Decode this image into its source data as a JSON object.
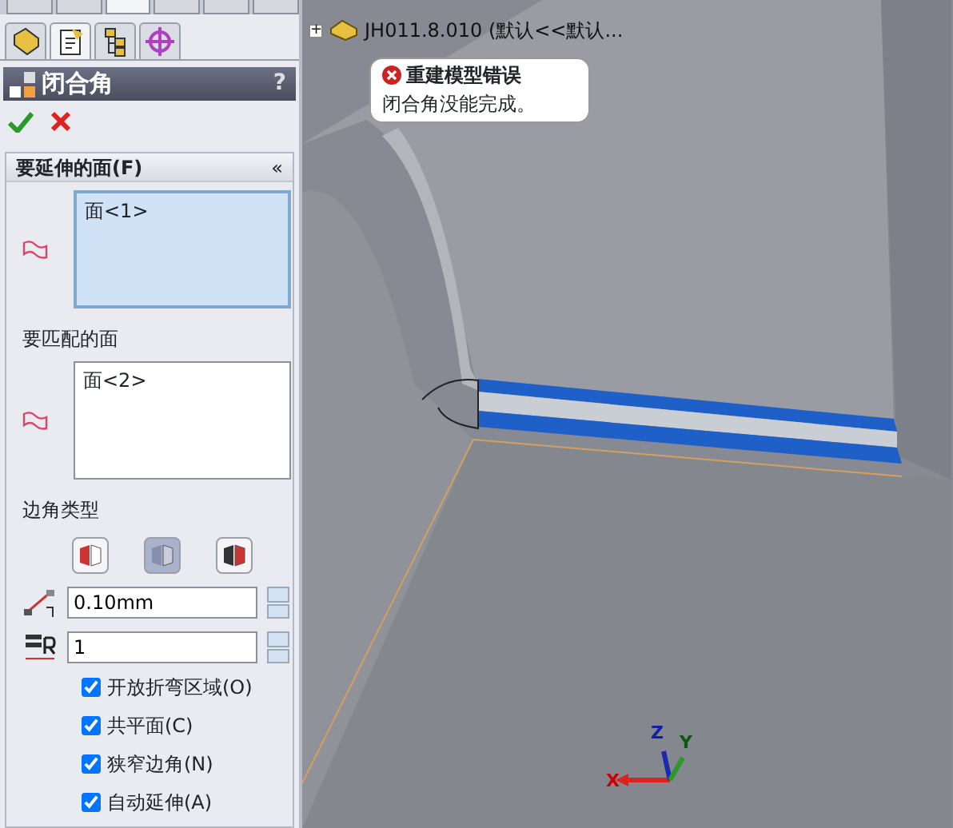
{
  "top_tabs": [
    {
      "selected": false
    },
    {
      "selected": false
    },
    {
      "selected": true
    },
    {
      "selected": false
    },
    {
      "selected": false
    },
    {
      "selected": false
    }
  ],
  "panel_tabs": [
    {
      "selected": false
    },
    {
      "selected": true
    },
    {
      "selected": false
    },
    {
      "selected": false
    }
  ],
  "property_manager": {
    "title": "闭合角",
    "help": "?"
  },
  "faces_to_extend": {
    "title": "要延伸的面(F)",
    "collapse": "«",
    "items": [
      "面<1>"
    ],
    "active": true
  },
  "faces_to_match": {
    "label": "要匹配的面",
    "items": [
      "面<2>"
    ],
    "active": false
  },
  "corner_type": {
    "label": "边角类型",
    "options": [
      {
        "selected": false
      },
      {
        "selected": true
      },
      {
        "selected": false
      }
    ]
  },
  "fields": [
    {
      "kind": "gap",
      "value": "0.10mm"
    },
    {
      "kind": "ratio",
      "value": "1"
    }
  ],
  "checkboxes": [
    {
      "label": "开放折弯区域(O)",
      "checked": true
    },
    {
      "label": "共平面(C)",
      "checked": true
    },
    {
      "label": "狭窄边角(N)",
      "checked": true
    },
    {
      "label": "自动延伸(A)",
      "checked": true
    }
  ],
  "tree": {
    "expander": "+",
    "label": "JH011.8.010 (默认<<默认..."
  },
  "error": {
    "title": "重建模型错误",
    "message": "闭合角没能完成。"
  },
  "axes": [
    "Z",
    "Y",
    "X"
  ]
}
